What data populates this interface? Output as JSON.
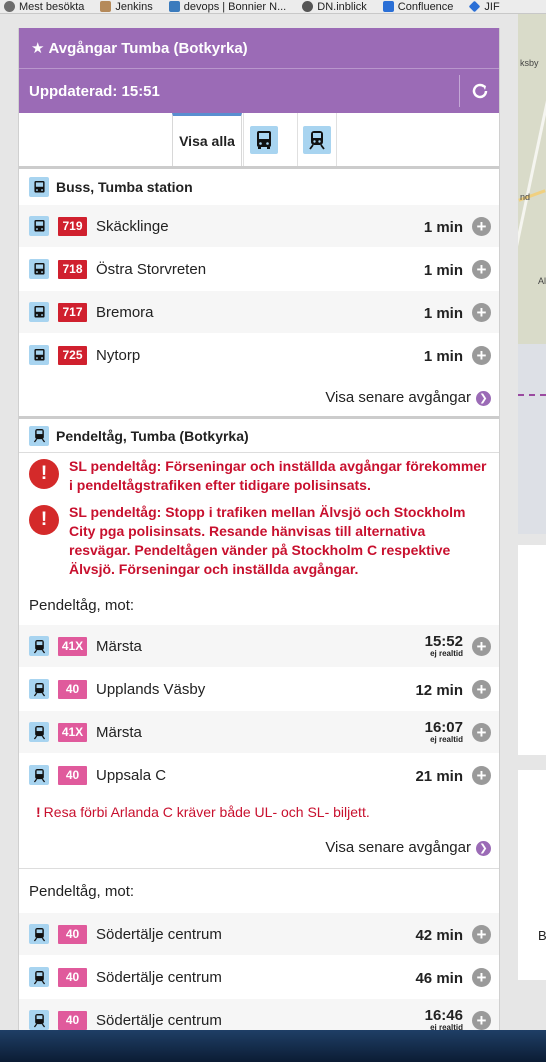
{
  "bookmarks": [
    {
      "label": "Mest besökta",
      "color": "#6d6d6d"
    },
    {
      "label": "Jenkins",
      "color": "#b58a5a"
    },
    {
      "label": "devops | Bonnier N...",
      "color": "#3b7bbd"
    },
    {
      "label": "DN.inblick",
      "color": "#555555"
    },
    {
      "label": "Confluence",
      "color": "#2a6fd6"
    },
    {
      "label": "JIF",
      "color": "#2a6fd6"
    }
  ],
  "map": {
    "label_top": "ksby",
    "label_mid": "nd",
    "label_right": "Al"
  },
  "sidebar_letter": "B",
  "header": {
    "title": "Avgångar Tumba (Botkyrka)",
    "updated": "Uppdaterad: 15:51"
  },
  "filters": {
    "all_label": "Visa alla"
  },
  "bus": {
    "title": "Buss, Tumba station",
    "rows": [
      {
        "line": "719",
        "dest": "Skäcklinge",
        "time": "1 min"
      },
      {
        "line": "718",
        "dest": "Östra Storvreten",
        "time": "1 min"
      },
      {
        "line": "717",
        "dest": "Bremora",
        "time": "1 min"
      },
      {
        "line": "725",
        "dest": "Nytorp",
        "time": "1 min"
      }
    ],
    "later": "Visa senare avgångar"
  },
  "train": {
    "title": "Pendeltåg, Tumba (Botkyrka)",
    "alerts": [
      "SL pendeltåg: Förseningar och inställda avgångar förekommer i pendeltågstrafiken efter tidigare polisinsats.",
      "SL pendeltåg: Stopp i trafiken mellan Älvsjö och Stockholm City pga polisinsats. Resande hänvisas till alternativa resvägar. Pendeltågen vänder på Stockholm C respektive Älvsjö. Förseningar och inställda avgångar."
    ],
    "group1": {
      "heading": "Pendeltåg, mot:",
      "rows": [
        {
          "line": "41X",
          "dest": "Märsta",
          "time": "15:52",
          "sub": "ej realtid"
        },
        {
          "line": "40",
          "dest": "Upplands Väsby",
          "time": "12 min",
          "sub": ""
        },
        {
          "line": "41X",
          "dest": "Märsta",
          "time": "16:07",
          "sub": "ej realtid"
        },
        {
          "line": "40",
          "dest": "Uppsala C",
          "time": "21 min",
          "sub": ""
        }
      ],
      "note": "Resa förbi Arlanda C kräver både UL- och SL- biljett.",
      "later": "Visa senare avgångar"
    },
    "group2": {
      "heading": "Pendeltåg, mot:",
      "rows": [
        {
          "line": "40",
          "dest": "Södertälje centrum",
          "time": "42 min",
          "sub": ""
        },
        {
          "line": "40",
          "dest": "Södertälje centrum",
          "time": "46 min",
          "sub": ""
        },
        {
          "line": "40",
          "dest": "Södertälje centrum",
          "time": "16:46",
          "sub": "ej realtid"
        }
      ]
    }
  },
  "colors": {
    "header": "#9b6bb6",
    "bus_badge": "#d0202e",
    "train_badge": "#e05a9c",
    "alert": "#c8102e",
    "icon_bg": "#a8d4f0"
  }
}
